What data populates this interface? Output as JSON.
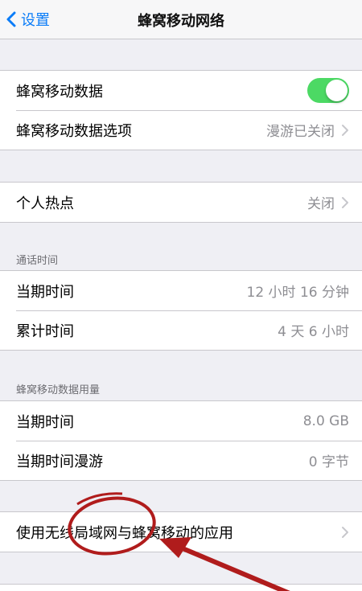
{
  "navbar": {
    "back_label": "设置",
    "title": "蜂窝移动网络"
  },
  "group1": {
    "cellular_data_label": "蜂窝移动数据",
    "cellular_data_on": true,
    "options_label": "蜂窝移动数据选项",
    "options_value": "漫游已关闭"
  },
  "group2": {
    "hotspot_label": "个人热点",
    "hotspot_value": "关闭"
  },
  "call_time": {
    "header": "通话时间",
    "current_label": "当期时间",
    "current_value": "12 小时 16 分钟",
    "lifetime_label": "累计时间",
    "lifetime_value": "4 天 6 小时"
  },
  "usage": {
    "header": "蜂窝移动数据用量",
    "current_label": "当期时间",
    "current_value": "8.0 GB",
    "roaming_label": "当期时间漫游",
    "roaming_value": "0 字节"
  },
  "wlan_apps": {
    "label": "使用无线局域网与蜂窝移动的应用"
  },
  "colors": {
    "accent": "#0a7cf8",
    "toggle_on": "#4cd964",
    "annotation": "#b01c1c",
    "background": "#efeff4"
  }
}
